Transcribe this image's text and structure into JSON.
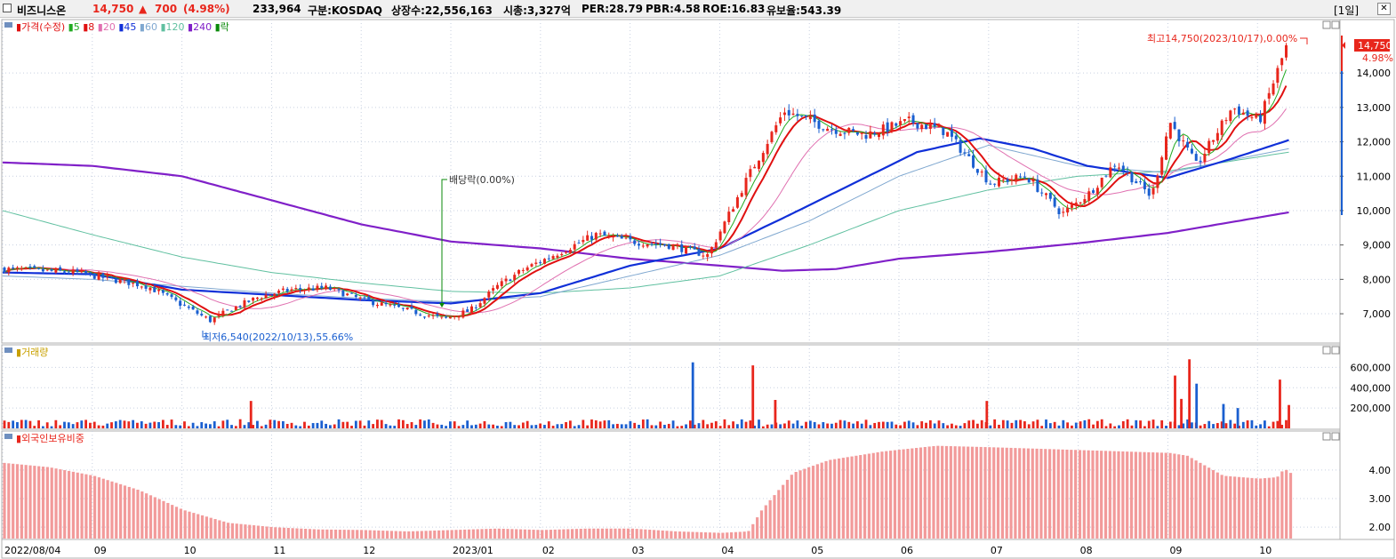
{
  "header": {
    "stock_name": "비즈니스온",
    "price": "14,750",
    "change_arrow": "▲",
    "change": "700",
    "change_pct": "(4.98%)",
    "volume": "233,964",
    "market": "구분:KOSDAQ",
    "shares": "상장수:22,556,163",
    "market_cap": "시총:3,327억",
    "per": "PER:28.79",
    "pbr": "PBR:4.58",
    "roe": "ROE:16.83",
    "reserve": "유보율:543.39",
    "period_label": "[1일]",
    "close_label": "✕"
  },
  "colors": {
    "up": "#e8261c",
    "down": "#1a5fd0",
    "ma5": "#22aa22",
    "ma8": "#e01010",
    "ma20": "#e070b0",
    "ma45": "#1030d8",
    "ma60": "#80a8d0",
    "ma120": "#60c0a0",
    "ma240": "#8020c8",
    "foreign": "#f29a9a"
  },
  "chart_data": [
    {
      "type": "candlestick",
      "legend_title": "가격(수정)",
      "legend": [
        {
          "name": "5",
          "color": "#22aa22"
        },
        {
          "name": "8",
          "color": "#e01010"
        },
        {
          "name": "20",
          "color": "#e070b0"
        },
        {
          "name": "45",
          "color": "#1030d8"
        },
        {
          "name": "60",
          "color": "#80a8d0"
        },
        {
          "name": "120",
          "color": "#60c0a0"
        },
        {
          "name": "240",
          "color": "#8020c8"
        },
        {
          "name": "락",
          "color": "#0a8a0a"
        }
      ],
      "y_ticks": [
        7000,
        8000,
        9000,
        10000,
        11000,
        12000,
        13000,
        14000
      ],
      "y_tick_labels": [
        "7,000",
        "8,000",
        "9,000",
        "10,000",
        "11,000",
        "12,000",
        "13,000",
        "14,000"
      ],
      "ylim": [
        6200,
        15400
      ],
      "x_tick_labels": [
        "2022/08/04",
        "09",
        "10",
        "11",
        "12",
        "2023/01",
        "02",
        "03",
        "04",
        "05",
        "06",
        "07",
        "08",
        "09",
        "10"
      ],
      "x_tick_months": [
        0,
        1,
        2,
        3,
        4,
        5,
        6,
        7,
        8,
        9,
        10,
        11,
        12,
        13,
        14
      ],
      "price_path": [
        [
          0,
          8300
        ],
        [
          0.4,
          8250
        ],
        [
          0.8,
          8200
        ],
        [
          1.2,
          8000
        ],
        [
          1.6,
          7800
        ],
        [
          1.95,
          7300
        ],
        [
          2.3,
          6800
        ],
        [
          2.5,
          7100
        ],
        [
          2.85,
          7500
        ],
        [
          3.2,
          7700
        ],
        [
          3.6,
          7750
        ],
        [
          4.0,
          7400
        ],
        [
          4.5,
          7100
        ],
        [
          4.9,
          6850
        ],
        [
          5.2,
          7100
        ],
        [
          5.5,
          7800
        ],
        [
          5.8,
          8300
        ],
        [
          6.2,
          8800
        ],
        [
          6.6,
          9300
        ],
        [
          7.0,
          9100
        ],
        [
          7.4,
          9000
        ],
        [
          7.85,
          8700
        ],
        [
          8.3,
          11000
        ],
        [
          8.7,
          12900
        ],
        [
          9.2,
          12400
        ],
        [
          9.6,
          12200
        ],
        [
          10.1,
          12600
        ],
        [
          10.5,
          12300
        ],
        [
          11.0,
          10800
        ],
        [
          11.4,
          11000
        ],
        [
          11.8,
          9900
        ],
        [
          12.1,
          10500
        ],
        [
          12.4,
          11400
        ],
        [
          12.8,
          10400
        ],
        [
          13.0,
          12600
        ],
        [
          13.3,
          11300
        ],
        [
          13.7,
          13000
        ],
        [
          14.0,
          12600
        ],
        [
          14.3,
          14750
        ]
      ],
      "ma_paths": {
        "ma45": [
          [
            0,
            8200
          ],
          [
            1,
            8150
          ],
          [
            2,
            7700
          ],
          [
            3,
            7550
          ],
          [
            4,
            7400
          ],
          [
            5,
            7300
          ],
          [
            6,
            7600
          ],
          [
            7,
            8400
          ],
          [
            8,
            8900
          ],
          [
            8.8,
            9900
          ],
          [
            9.5,
            10800
          ],
          [
            10.2,
            11700
          ],
          [
            10.9,
            12100
          ],
          [
            11.5,
            11800
          ],
          [
            12.1,
            11300
          ],
          [
            12.6,
            11100
          ],
          [
            13,
            10950
          ],
          [
            13.7,
            11500
          ],
          [
            14.35,
            12050
          ]
        ],
        "ma60": [
          [
            0,
            8100
          ],
          [
            1,
            8000
          ],
          [
            2,
            7800
          ],
          [
            3,
            7600
          ],
          [
            4,
            7450
          ],
          [
            5,
            7350
          ],
          [
            6,
            7500
          ],
          [
            7,
            8100
          ],
          [
            8,
            8700
          ],
          [
            9,
            9700
          ],
          [
            10,
            11000
          ],
          [
            11,
            11900
          ],
          [
            12,
            11300
          ],
          [
            13,
            11100
          ],
          [
            14.35,
            11800
          ]
        ],
        "ma120": [
          [
            0,
            10000
          ],
          [
            1,
            9300
          ],
          [
            2,
            8650
          ],
          [
            3,
            8200
          ],
          [
            4,
            7900
          ],
          [
            5,
            7650
          ],
          [
            6,
            7600
          ],
          [
            7,
            7750
          ],
          [
            8,
            8100
          ],
          [
            9,
            9000
          ],
          [
            10,
            10000
          ],
          [
            11,
            10600
          ],
          [
            12,
            11000
          ],
          [
            13,
            11150
          ],
          [
            14.35,
            11700
          ]
        ],
        "ma240": [
          [
            0,
            11400
          ],
          [
            1,
            11300
          ],
          [
            2,
            11000
          ],
          [
            3,
            10300
          ],
          [
            4,
            9600
          ],
          [
            5,
            9100
          ],
          [
            6,
            8900
          ],
          [
            7,
            8600
          ],
          [
            8,
            8400
          ],
          [
            8.7,
            8250
          ],
          [
            9.3,
            8300
          ],
          [
            10,
            8600
          ],
          [
            11,
            8800
          ],
          [
            12,
            9050
          ],
          [
            13,
            9350
          ],
          [
            14.35,
            9950
          ]
        ]
      },
      "annotations": {
        "high": "최고14,750(2023/10/17),0.00%",
        "low": "최저6,540(2022/10/13),55.66%",
        "dividend": "배당락(0.00%)",
        "last_price": "14,750",
        "last_pct": "4.98%"
      }
    },
    {
      "type": "bar",
      "legend_title": "거래량",
      "y_ticks": [
        200000,
        400000,
        600000
      ],
      "y_tick_labels": [
        "200,000",
        "400,000",
        "600,000"
      ],
      "ylim": [
        0,
        700000
      ],
      "spikes": [
        {
          "x": 2.77,
          "value": 270000,
          "dir": "up"
        },
        {
          "x": 7.7,
          "value": 650000,
          "dir": "down"
        },
        {
          "x": 8.37,
          "value": 620000,
          "dir": "up"
        },
        {
          "x": 8.62,
          "value": 280000,
          "dir": "up"
        },
        {
          "x": 10.98,
          "value": 270000,
          "dir": "up"
        },
        {
          "x": 13.08,
          "value": 520000,
          "dir": "up"
        },
        {
          "x": 13.15,
          "value": 290000,
          "dir": "up"
        },
        {
          "x": 13.24,
          "value": 680000,
          "dir": "up"
        },
        {
          "x": 13.32,
          "value": 440000,
          "dir": "down"
        },
        {
          "x": 13.62,
          "value": 240000,
          "dir": "down"
        },
        {
          "x": 13.78,
          "value": 200000,
          "dir": "down"
        },
        {
          "x": 14.25,
          "value": 480000,
          "dir": "up"
        },
        {
          "x": 14.35,
          "value": 230000,
          "dir": "up"
        }
      ]
    },
    {
      "type": "bar",
      "legend_title": "외국인보유비중",
      "y_ticks": [
        2,
        3,
        4
      ],
      "y_tick_labels": [
        "2.00",
        "3.00",
        "4.00"
      ],
      "ylim": [
        1.6,
        4.9
      ],
      "path": [
        [
          0,
          4.25
        ],
        [
          0.5,
          4.1
        ],
        [
          1,
          3.8
        ],
        [
          1.5,
          3.3
        ],
        [
          2,
          2.6
        ],
        [
          2.5,
          2.15
        ],
        [
          3,
          2.0
        ],
        [
          3.5,
          1.92
        ],
        [
          4,
          1.9
        ],
        [
          4.5,
          1.85
        ],
        [
          5,
          1.9
        ],
        [
          5.5,
          1.95
        ],
        [
          6,
          1.9
        ],
        [
          6.5,
          1.95
        ],
        [
          7,
          1.95
        ],
        [
          7.5,
          1.85
        ],
        [
          8,
          1.8
        ],
        [
          8.3,
          1.85
        ],
        [
          8.45,
          2.6
        ],
        [
          8.8,
          3.9
        ],
        [
          9.2,
          4.35
        ],
        [
          9.8,
          4.65
        ],
        [
          10.4,
          4.85
        ],
        [
          11,
          4.8
        ],
        [
          11.5,
          4.75
        ],
        [
          12,
          4.7
        ],
        [
          12.5,
          4.65
        ],
        [
          13,
          4.6
        ],
        [
          13.2,
          4.5
        ],
        [
          13.6,
          3.8
        ],
        [
          14,
          3.7
        ],
        [
          14.2,
          3.75
        ],
        [
          14.28,
          4.05
        ],
        [
          14.35,
          3.9
        ]
      ]
    }
  ]
}
